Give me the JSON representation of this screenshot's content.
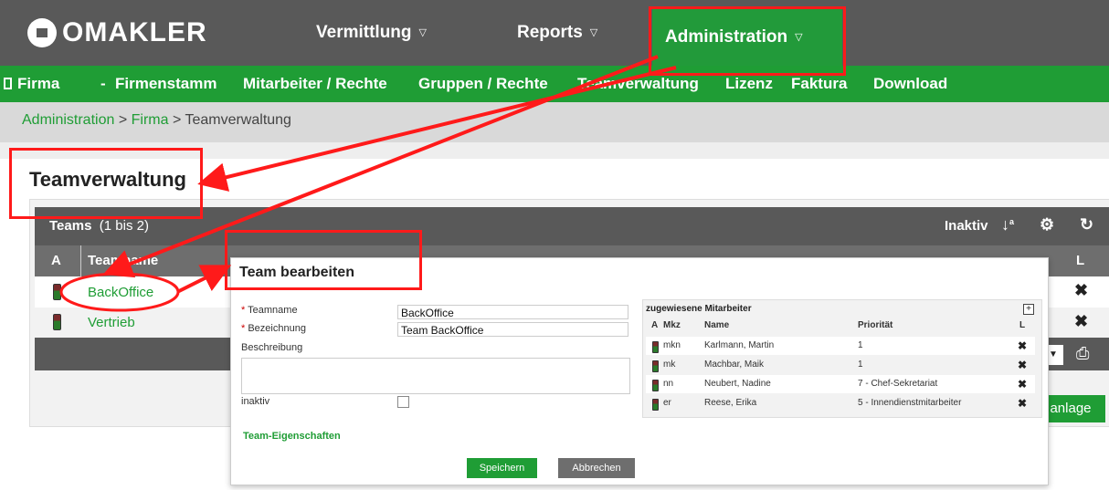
{
  "brand": "OMAKLER",
  "topnav": [
    {
      "label": "Vermittlung"
    },
    {
      "label": "Reports"
    },
    {
      "label": "Administration"
    }
  ],
  "subnav": {
    "firma": "Firma",
    "dash": "-",
    "items": [
      "Firmenstamm",
      "Mitarbeiter / Rechte",
      "Gruppen / Rechte",
      "Teamverwaltung",
      "Lizenz",
      "Faktura",
      "Download"
    ]
  },
  "breadcrumb": {
    "admin": "Administration",
    "sep1": " > ",
    "firma": "Firma",
    "sep2": " > ",
    "current": "Teamverwaltung"
  },
  "page_title": "Teamverwaltung",
  "teams_table": {
    "title": "Teams",
    "count": "(1 bis 2)",
    "inaktiv_label": "Inaktiv",
    "col_a": "A",
    "col_teamname": "Teamname",
    "col_l": "L",
    "rows": [
      {
        "name": "BackOffice"
      },
      {
        "name": "Vertrieb"
      }
    ],
    "neuanlage_label": "anlage"
  },
  "dialog": {
    "title": "Team bearbeiten",
    "req_mark": "*",
    "teamname_label": "Teamname",
    "teamname_value": "BackOffice",
    "bezeichnung_label": "Bezeichnung",
    "bezeichnung_value": "Team BackOffice",
    "beschreibung_label": "Beschreibung",
    "inaktiv_label": "inaktiv",
    "team_eigenschaften": "Team-Eigenschaften",
    "save_label": "Speichern",
    "cancel_label": "Abbrechen",
    "mitarbeiter": {
      "title": "zugewiesene Mitarbeiter",
      "col_a": "A",
      "col_mkz": "Mkz",
      "col_name": "Name",
      "col_prioritaet": "Priorität",
      "col_l": "L",
      "rows": [
        {
          "mkz": "mkn",
          "name": "Karlmann, Martin",
          "prio": "1"
        },
        {
          "mkz": "mk",
          "name": "Machbar, Maik",
          "prio": "1"
        },
        {
          "mkz": "nn",
          "name": "Neubert, Nadine",
          "prio": "7 - Chef-Sekretariat"
        },
        {
          "mkz": "er",
          "name": "Reese, Erika",
          "prio": "5 - Innendienstmitarbeiter"
        }
      ]
    }
  },
  "colors": {
    "green": "#1f9d35",
    "topbar": "#595959",
    "annotation": "#ff1a1a"
  },
  "icons": [
    "home-logo-icon",
    "sort-az-icon",
    "settings-gears-icon",
    "refresh-icon",
    "delete-icon",
    "print-icon",
    "add-icon",
    "traffic-light-icon"
  ]
}
